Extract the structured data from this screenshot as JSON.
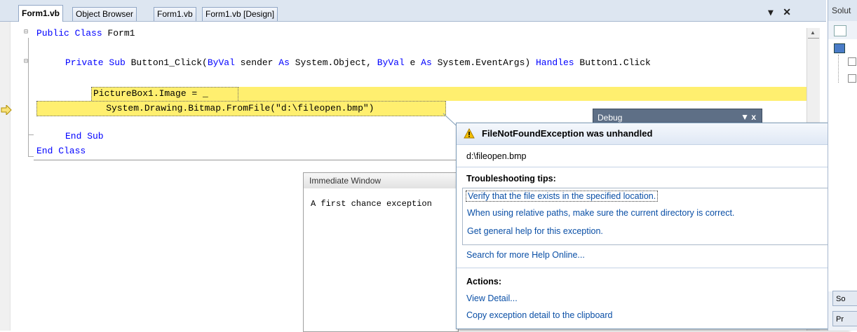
{
  "tabs": [
    {
      "label": "Form1.vb",
      "active": true
    },
    {
      "label": "Object Browser",
      "active": false
    },
    {
      "label": "Form1.vb",
      "active": false
    },
    {
      "label": "Form1.vb [Design]",
      "active": false
    }
  ],
  "tab_controls": {
    "dropdown": "▾",
    "close": "✕"
  },
  "code": {
    "line1_kw": "Public Class",
    "line1_rest": " Form1",
    "line2_kw1": "Private Sub",
    "line2_mid": " Button1_Click(",
    "line2_kw2": "ByVal",
    "line2_mid2": " sender ",
    "line2_kw3": "As",
    "line2_mid3": " System.Object, ",
    "line2_kw4": "ByVal",
    "line2_mid4": " e ",
    "line2_kw5": "As",
    "line2_mid5": " System.EventArgs) ",
    "line2_kw6": "Handles",
    "line2_end": " Button1.Click",
    "line3": "PictureBox1.Image = _",
    "line4": "    System.Drawing.Bitmap.FromFile(\"d:\\fileopen.bmp\")",
    "line5_kw": "End Sub",
    "line6_kw": "End Class"
  },
  "immediate": {
    "title": "Immediate Window",
    "content": "A first chance exception"
  },
  "debug_window": {
    "title": "Debug",
    "controls": "▼ x"
  },
  "exception": {
    "title": "FileNotFoundException was unhandled",
    "message": "d:\\fileopen.bmp",
    "tips_heading": "Troubleshooting tips:",
    "tips": [
      "Verify that the file exists in the specified location.",
      "When using relative paths, make sure the current directory is correct.",
      "Get general help for this exception."
    ],
    "search_link": "Search for more Help Online...",
    "actions_heading": "Actions:",
    "actions": [
      "View Detail...",
      "Copy exception detail to the clipboard"
    ],
    "warning_color": "#e8a000"
  },
  "solution": {
    "title": "Solut",
    "tab1": "So",
    "tab2": "Pr"
  }
}
